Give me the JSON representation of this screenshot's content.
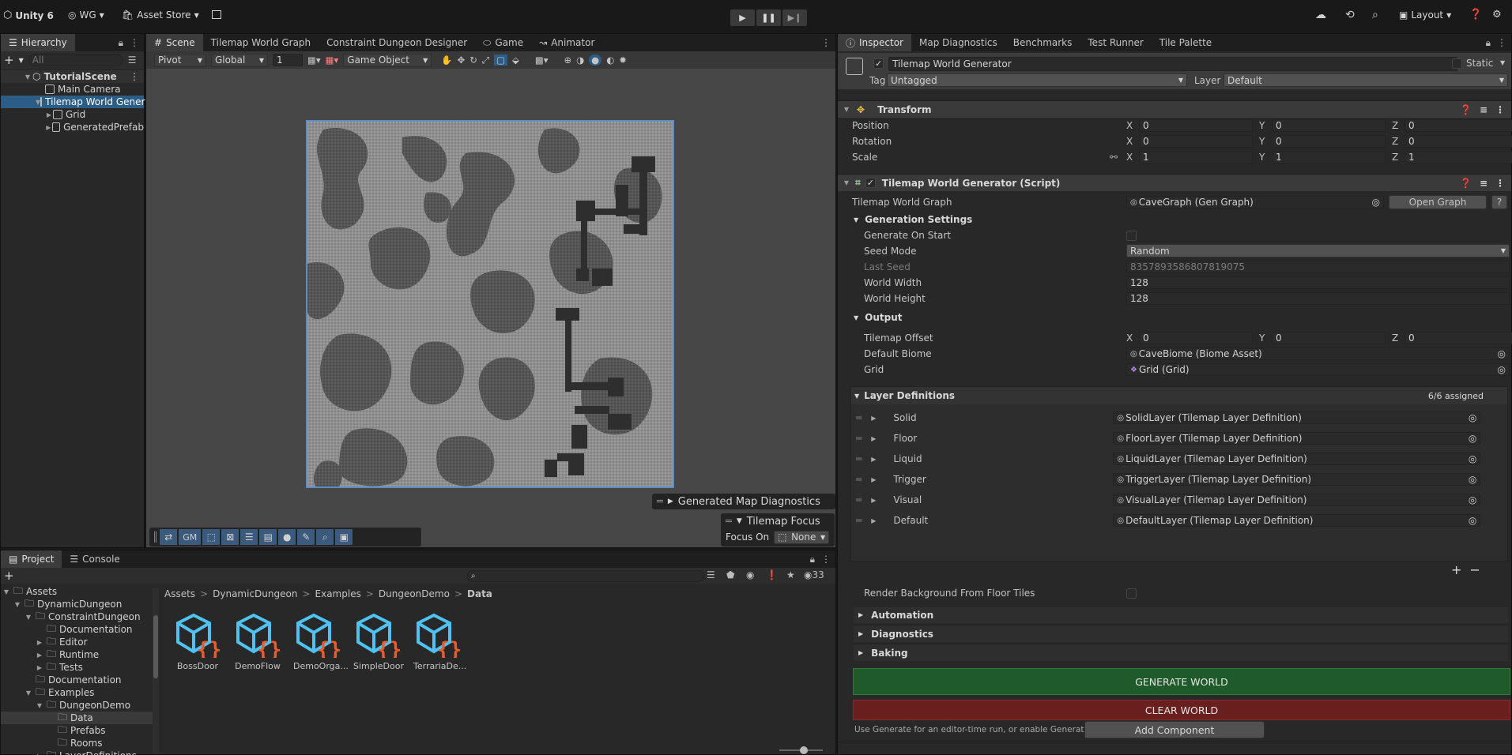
{
  "top": {
    "app": "Unity 6",
    "account": "WG",
    "asset_store": "Asset Store",
    "layout": "Layout"
  },
  "hierarchy": {
    "tab": "Hierarchy",
    "search_placeholder": "All",
    "scene": "TutorialScene",
    "items": [
      "Main Camera",
      "Tilemap World Generator",
      "Grid",
      "GeneratedPrefab"
    ]
  },
  "scene_tabs": [
    "Scene",
    "Tilemap World Graph",
    "Constraint Dungeon Designer",
    "Game",
    "Animator"
  ],
  "scene_toolbar": {
    "pivot": "Pivot",
    "global": "Global",
    "grid_value": "1",
    "game_object": "Game Object"
  },
  "scene_overlay": {
    "diagnostics": "Generated Map Diagnostics",
    "focus_title": "Tilemap Focus",
    "focus_on": "Focus On",
    "focus_value": "None",
    "gm": "GM"
  },
  "project": {
    "tabs": [
      "Project",
      "Console"
    ],
    "count": "33",
    "breadcrumb": [
      "Assets",
      "DynamicDungeon",
      "Examples",
      "DungeonDemo",
      "Data"
    ],
    "tree": [
      {
        "label": "Assets",
        "depth": 0
      },
      {
        "label": "DynamicDungeon",
        "depth": 1
      },
      {
        "label": "ConstraintDungeon",
        "depth": 2
      },
      {
        "label": "Documentation",
        "depth": 3
      },
      {
        "label": "Editor",
        "depth": 3
      },
      {
        "label": "Runtime",
        "depth": 3
      },
      {
        "label": "Tests",
        "depth": 3
      },
      {
        "label": "Documentation",
        "depth": 2
      },
      {
        "label": "Examples",
        "depth": 2
      },
      {
        "label": "DungeonDemo",
        "depth": 3
      },
      {
        "label": "Data",
        "depth": 4
      },
      {
        "label": "Prefabs",
        "depth": 4
      },
      {
        "label": "Rooms",
        "depth": 4
      },
      {
        "label": "LayerDefinitions",
        "depth": 3
      }
    ],
    "assets": [
      "BossDoor",
      "DemoFlow",
      "DemoOrga...",
      "SimpleDoor",
      "TerrariaDe..."
    ]
  },
  "inspector": {
    "tabs": [
      "Inspector",
      "Map Diagnostics",
      "Benchmarks",
      "Test Runner",
      "Tile Palette"
    ],
    "object_name": "Tilemap World Generator",
    "static": "Static",
    "tag_label": "Tag",
    "tag": "Untagged",
    "layer_label": "Layer",
    "layer": "Default",
    "transform": {
      "title": "Transform",
      "rows": [
        {
          "label": "Position",
          "x": "0",
          "y": "0",
          "z": "0"
        },
        {
          "label": "Rotation",
          "x": "0",
          "y": "0",
          "z": "0"
        },
        {
          "label": "Scale",
          "x": "1",
          "y": "1",
          "z": "1"
        }
      ]
    },
    "script": {
      "title": "Tilemap World Generator (Script)",
      "graph_label": "Tilemap World Graph",
      "graph_value": "CaveGraph (Gen Graph)",
      "open_graph": "Open Graph",
      "gen_settings": "Generation Settings",
      "generate_on_start": "Generate On Start",
      "seed_mode_label": "Seed Mode",
      "seed_mode": "Random",
      "last_seed_label": "Last Seed",
      "last_seed": "8357893586807819075",
      "world_width_label": "World Width",
      "world_width": "128",
      "world_height_label": "World Height",
      "world_height": "128",
      "output": "Output",
      "tilemap_offset": "Tilemap Offset",
      "offset": {
        "x": "0",
        "y": "0",
        "z": "0"
      },
      "default_biome_label": "Default Biome",
      "default_biome": "CaveBiome (Biome Asset)",
      "grid_label": "Grid",
      "grid": "Grid (Grid)",
      "layer_defs": "Layer Definitions",
      "assigned": "6/6 assigned",
      "layers": [
        {
          "name": "Solid",
          "value": "SolidLayer (Tilemap Layer Definition)"
        },
        {
          "name": "Floor",
          "value": "FloorLayer (Tilemap Layer Definition)"
        },
        {
          "name": "Liquid",
          "value": "LiquidLayer (Tilemap Layer Definition)"
        },
        {
          "name": "Trigger",
          "value": "TriggerLayer (Tilemap Layer Definition)"
        },
        {
          "name": "Visual",
          "value": "VisualLayer (Tilemap Layer Definition)"
        },
        {
          "name": "Default",
          "value": "DefaultLayer (Tilemap Layer Definition)"
        }
      ],
      "render_bg": "Render Background From Floor Tiles",
      "automation": "Automation",
      "diagnostics": "Diagnostics",
      "baking": "Baking",
      "generate": "GENERATE WORLD",
      "clear": "CLEAR WORLD",
      "help": "Use Generate for an editor-time run, or enable Generate On Start for runtime generation."
    },
    "add_component": "Add Component"
  },
  "colors": {
    "generate_bg": "#1f5a2a",
    "clear_bg": "#6a1f1f",
    "selection": "#2c5d87",
    "asset_icon": "#4ec2f0",
    "asset_brace": "#f05a28"
  }
}
